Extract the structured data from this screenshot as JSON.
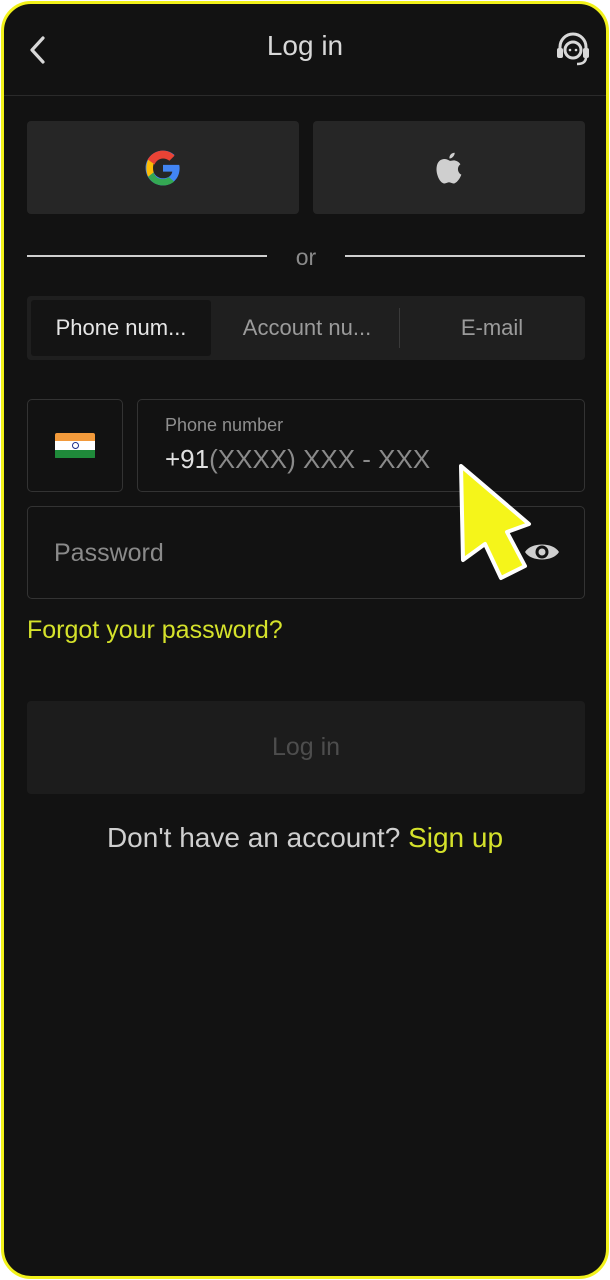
{
  "header": {
    "title": "Log in",
    "back_icon": "chevron-left-icon",
    "support_icon": "headset-support-icon"
  },
  "social": {
    "google_icon": "google-icon",
    "apple_icon": "apple-icon"
  },
  "divider": {
    "text": "or"
  },
  "tabs": [
    {
      "label": "Phone num...",
      "selected": true
    },
    {
      "label": "Account nu...",
      "selected": false
    },
    {
      "label": "E-mail",
      "selected": false
    }
  ],
  "country": {
    "flag": "india-flag-icon"
  },
  "phone": {
    "label": "Phone number",
    "prefix": "+91",
    "placeholder": "(XXXX) XXX - XXX"
  },
  "password": {
    "placeholder": "Password",
    "toggle_icon": "eye-icon"
  },
  "forgot": {
    "label": "Forgot your password?"
  },
  "login": {
    "label": "Log in"
  },
  "signup": {
    "text": "Don't have an account?",
    "link": "Sign up"
  },
  "colors": {
    "accent": "#d5e22b",
    "background": "#121212",
    "frame": "#f2f21a"
  }
}
